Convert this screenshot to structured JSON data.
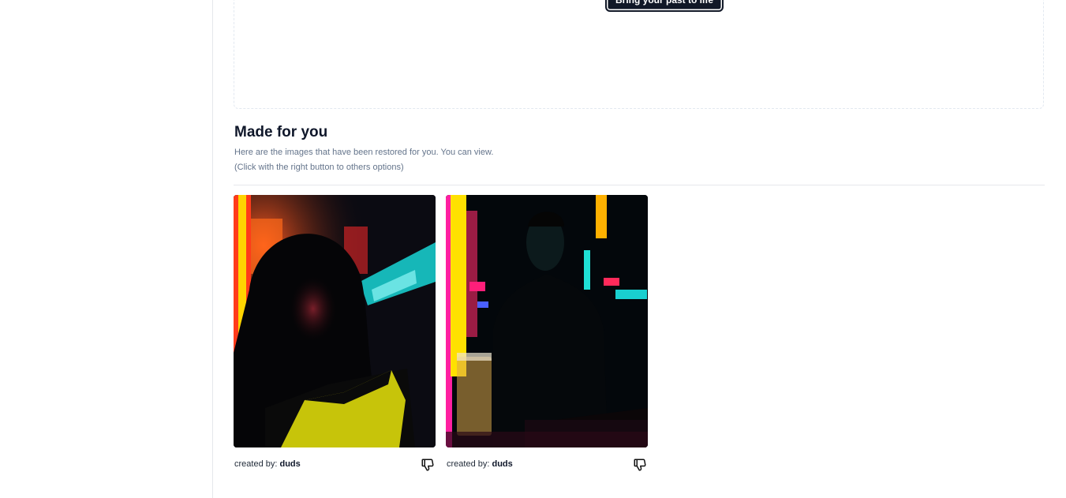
{
  "upload": {
    "cta_label": "Bring your past to life"
  },
  "section": {
    "title": "Made for you",
    "description": "Here are the images that have been restored for you. You can view.",
    "hint": "(Click with the right button to others options)"
  },
  "gallery": [
    {
      "credit_label": "created by:",
      "author": "duds",
      "icon": "thumbs-down-icon"
    },
    {
      "credit_label": "created by:",
      "author": "duds",
      "icon": "thumbs-down-icon"
    }
  ],
  "colors": {
    "cta_bg": "#111827",
    "border": "#e5e7eb",
    "muted_text": "#64748b"
  }
}
